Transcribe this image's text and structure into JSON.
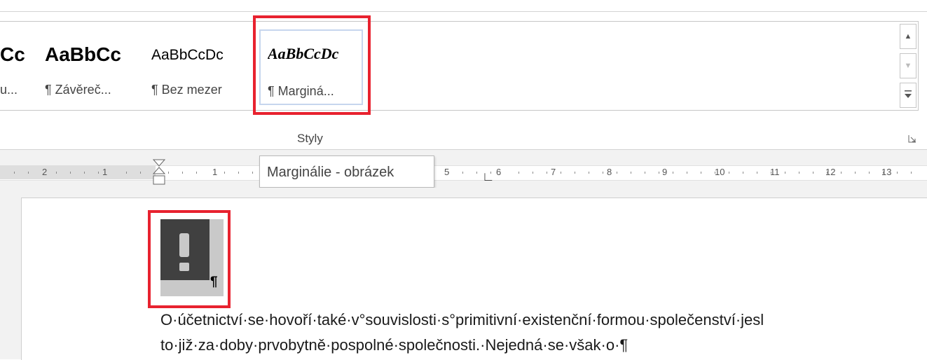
{
  "ribbon": {
    "styles": [
      {
        "preview": "Cc",
        "label": "u..."
      },
      {
        "preview": "AaBbCc",
        "label": "¶ Závěreč..."
      },
      {
        "preview": "AaBbCcDc",
        "label": "¶ Bez mezer"
      },
      {
        "preview": "AaBbCcDc",
        "label": "¶ Marginá..."
      }
    ],
    "group_label": "Styly",
    "scroll_up_icon": "triangle-up",
    "scroll_down_icon": "triangle-down",
    "more_icon": "more-down",
    "highlight_color": "#e8222f"
  },
  "ruler": {
    "ticks": [
      "2",
      "1",
      "1",
      "5",
      "6",
      "7",
      "8",
      "9",
      "10",
      "11",
      "12",
      "13"
    ]
  },
  "tooltip": {
    "text": "Marginálie - obrázek"
  },
  "document": {
    "image_pilcrow": "¶",
    "lines": [
      "O·účetnictví·se·hovoří·také·v°souvislosti·s°primitivní·existenční·formou·společenství·jesl",
      "to·již·za·doby·prvobytně·pospolné·společnosti.·Nejedná·se·však·o·¶"
    ]
  }
}
